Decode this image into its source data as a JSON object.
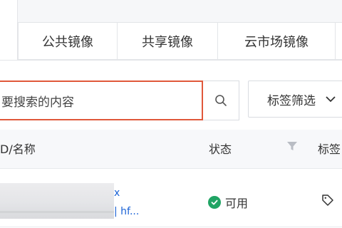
{
  "tabs": [
    {
      "label": "公共镜像"
    },
    {
      "label": "共享镜像"
    },
    {
      "label": "云市场镜像"
    }
  ],
  "search": {
    "placeholder": "要搜索的内容",
    "icon": "search-icon"
  },
  "filter": {
    "label": "标签筛选",
    "icon": "chevron-down-icon"
  },
  "table": {
    "columns": [
      "D/名称",
      "状态",
      "标签"
    ],
    "rows": [
      {
        "id_text": "x",
        "name_text": "| hf...",
        "status": "可用",
        "status_icon": "check-circle-icon",
        "tag_icon": "tag-icon"
      }
    ]
  },
  "colors": {
    "accent_error_border": "#e0583b",
    "status_ok": "#20a464",
    "link": "#1a62d6"
  }
}
